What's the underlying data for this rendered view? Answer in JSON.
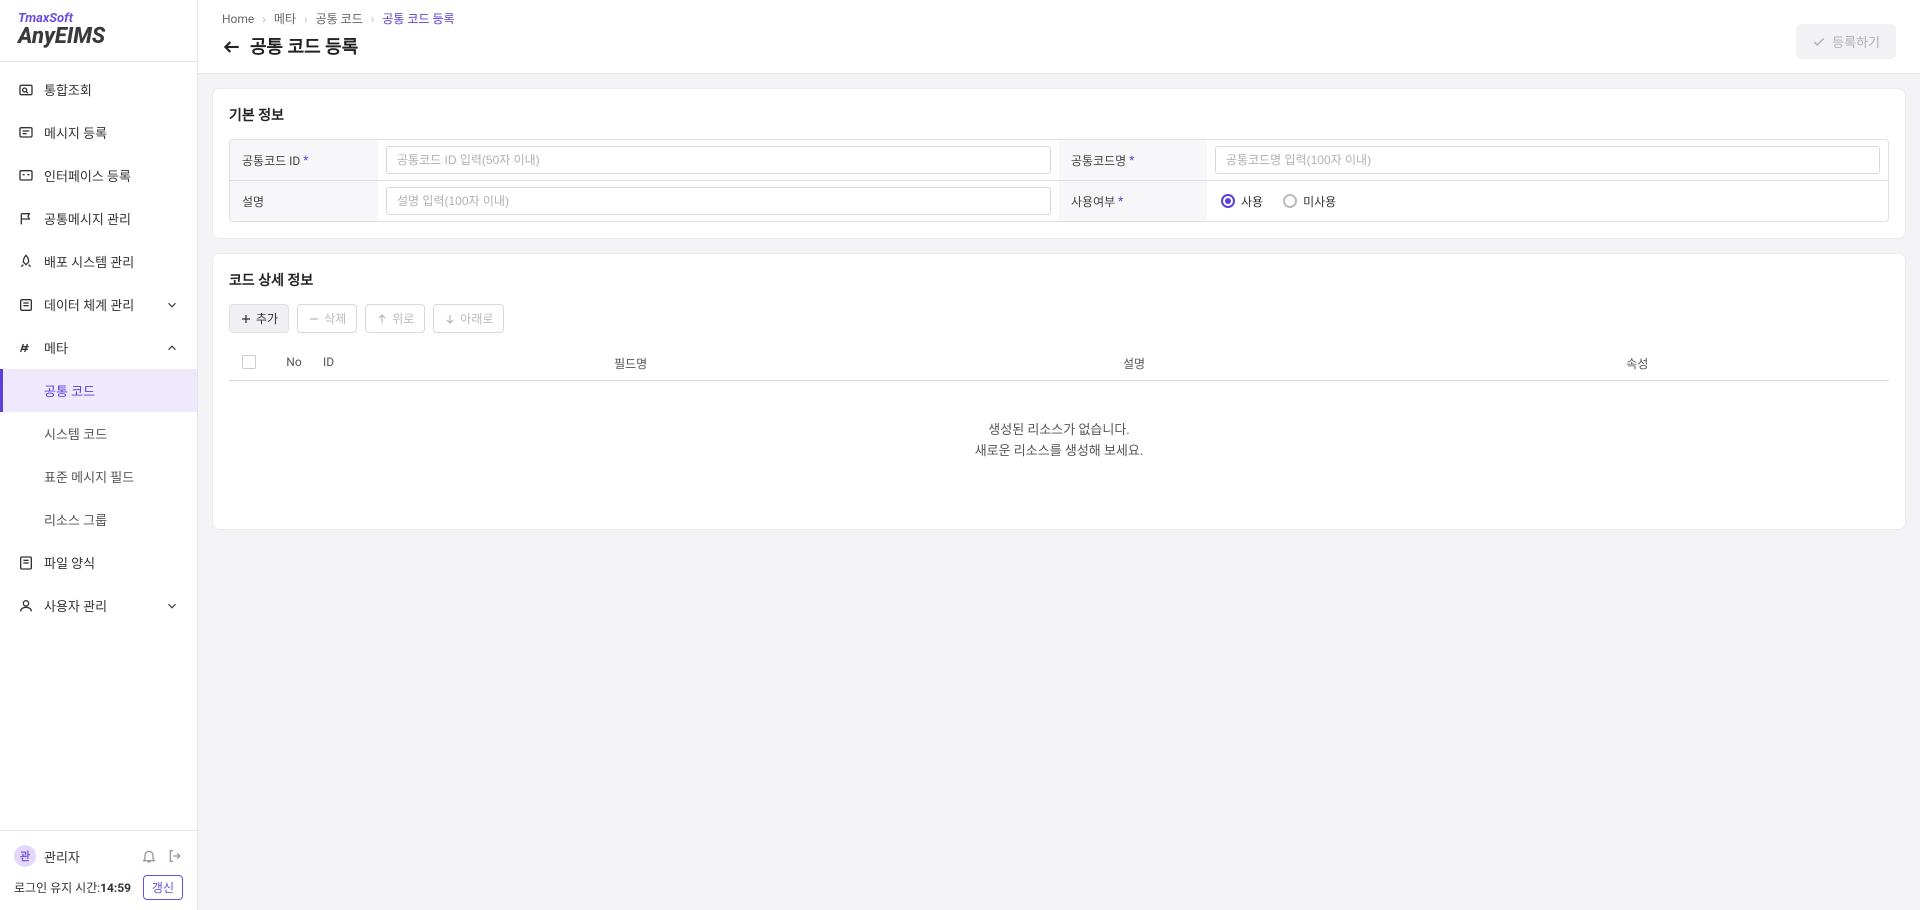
{
  "brand": {
    "company": "TmaxSoft",
    "product": "AnyEIMS"
  },
  "nav": {
    "items": [
      {
        "label": "통합조회"
      },
      {
        "label": "메시지 등록"
      },
      {
        "label": "인터페이스 등록"
      },
      {
        "label": "공통메시지 관리"
      },
      {
        "label": "배포 시스템 관리"
      },
      {
        "label": "데이터 체계 관리"
      },
      {
        "label": "메타"
      },
      {
        "label": "파일 양식"
      },
      {
        "label": "사용자 관리"
      }
    ],
    "meta_children": [
      {
        "label": "공통 코드"
      },
      {
        "label": "시스템 코드"
      },
      {
        "label": "표준 메시지 필드"
      },
      {
        "label": "리소스 그룹"
      }
    ]
  },
  "user": {
    "avatar_char": "관",
    "name": "관리자",
    "session_label": "로그인 유지 시간:",
    "session_time": "14:59",
    "refresh": "갱신"
  },
  "breadcrumb": [
    {
      "label": "Home"
    },
    {
      "label": "메타"
    },
    {
      "label": "공통 코드"
    },
    {
      "label": "공통 코드 등록"
    }
  ],
  "page_title": "공통 코드 등록",
  "submit_label": "등록하기",
  "section1": {
    "title": "기본 정보",
    "fields": {
      "code_id_label": "공통코드 ID",
      "code_id_placeholder": "공통코드 ID 입력(50자 이내)",
      "code_name_label": "공통코드명",
      "code_name_placeholder": "공통코드명 입력(100자 이내)",
      "desc_label": "설명",
      "desc_placeholder": "설명 입력(100자 이내)",
      "use_label": "사용여부",
      "use_on": "사용",
      "use_off": "미사용"
    }
  },
  "section2": {
    "title": "코드 상세 정보",
    "actions": {
      "add": "추가",
      "delete": "삭제",
      "up": "위로",
      "down": "아래로"
    },
    "columns": {
      "no": "No",
      "id": "ID",
      "field": "필드명",
      "desc": "설명",
      "attr": "속성"
    },
    "empty1": "생성된 리소스가 없습니다.",
    "empty2": "새로운 리소스를 생성해 보세요."
  }
}
